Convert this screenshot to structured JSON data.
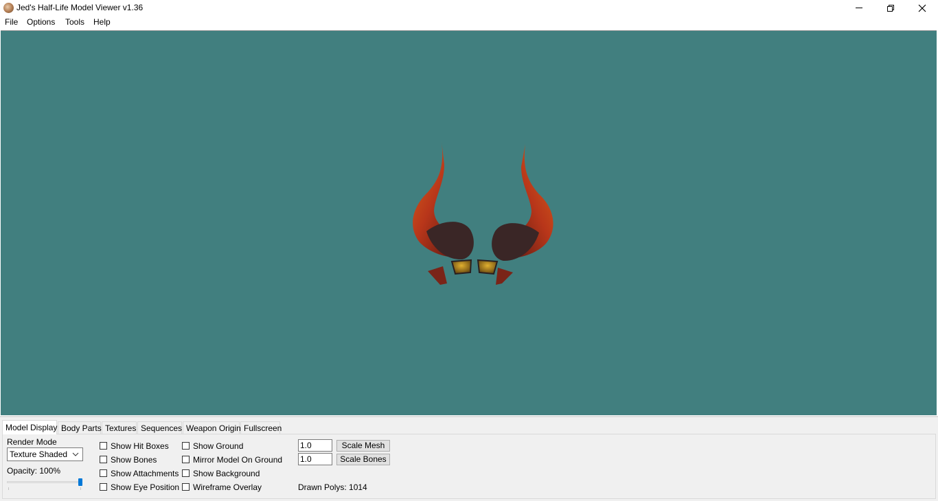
{
  "window": {
    "title": "Jed's Half-Life Model Viewer v1.36",
    "controls": [
      "minimize-icon",
      "maximize-icon",
      "close-icon"
    ]
  },
  "menu": {
    "file": "File",
    "options": "Options",
    "tools": "Tools",
    "help": "Help"
  },
  "viewport": {
    "background_color": "#417f7f",
    "model_colors": [
      "#c2451c",
      "#6e1e14",
      "#3b2a2a",
      "#c58f1e"
    ]
  },
  "tabs": {
    "model_display": "Model Display",
    "body_parts": "Body Parts",
    "textures": "Textures",
    "sequences": "Sequences",
    "weapon_origin": "Weapon Origin",
    "fullscreen": "Fullscreen",
    "active": "Model Display"
  },
  "model_display": {
    "render_mode_label": "Render Mode",
    "render_mode_value": "Texture Shaded",
    "opacity_label": "Opacity: 100%",
    "opacity_value": 1.0,
    "checkboxes": {
      "show_hit_boxes": "Show Hit Boxes",
      "show_bones": "Show Bones",
      "show_attachments": "Show Attachments",
      "show_eye_position": "Show Eye Position",
      "show_ground": "Show Ground",
      "mirror_model_on_ground": "Mirror Model On Ground",
      "show_background": "Show Background",
      "wireframe_overlay": "Wireframe Overlay"
    },
    "scale_mesh_value": "1.0",
    "scale_bones_value": "1.0",
    "scale_mesh_button": "Scale Mesh",
    "scale_bones_button": "Scale Bones",
    "drawn_polys": "Drawn Polys: 1014"
  }
}
